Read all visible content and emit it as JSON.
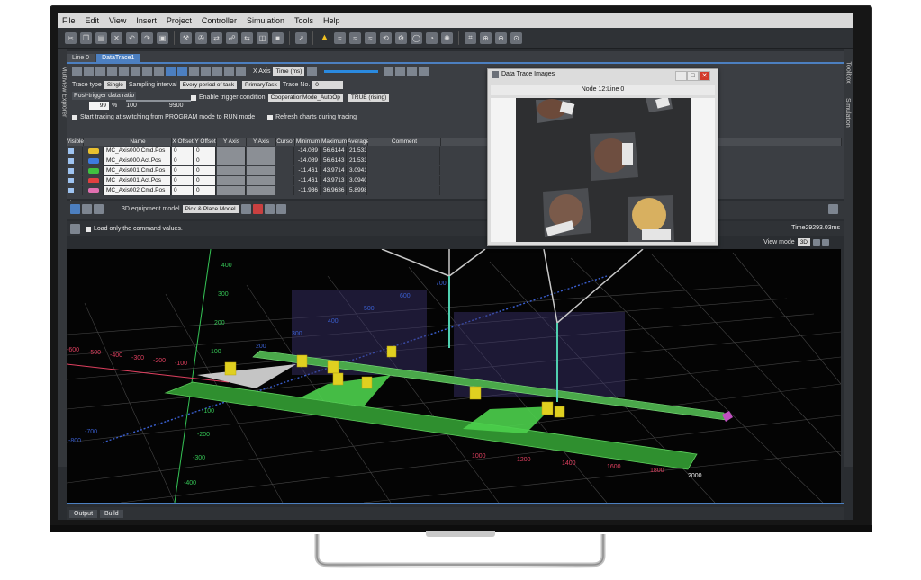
{
  "menu": [
    "File",
    "Edit",
    "View",
    "Insert",
    "Project",
    "Controller",
    "Simulation",
    "Tools",
    "Help"
  ],
  "side_labels": {
    "left": "Multiview Explorer",
    "right_top": "Toolbox",
    "right_bottom": "Simulation"
  },
  "tabs": [
    {
      "label": "Line 0",
      "active": false
    },
    {
      "label": "DataTrace1",
      "active": true
    }
  ],
  "trace": {
    "x_axis_label": "X Axis",
    "x_axis_value": "Time (ms)",
    "trace_type_label": "Trace type",
    "trace_type_value": "Single",
    "sampling_label": "Sampling interval",
    "sampling_value": "Every period of task",
    "task_value": "PrimaryTask",
    "trace_no_label": "Trace No.",
    "trace_no_value": "0",
    "post_trigger_label": "Post-trigger data ratio",
    "post_trigger_value": "99",
    "post_trigger_unit": "%",
    "slider_left": "100",
    "slider_right": "9900",
    "enable_trigger_label": "Enable trigger condition",
    "trigger_var": "CooperationMode_AutoOp",
    "trigger_cond": "TRUE (rising)",
    "start_tracing_label": "Start tracing at switching from PROGRAM mode to RUN mode",
    "refresh_label": "Refresh charts during tracing"
  },
  "grid": {
    "headers": [
      "Visible",
      "",
      "Name",
      "X Offset",
      "Y Offset",
      "Y Axis Min.",
      "Y Axis Max.",
      "Cursor",
      "Minimum",
      "Maximum",
      "Average",
      "Comment"
    ],
    "rows": [
      {
        "color": "#e8c030",
        "name": "MC_Axis000.Cmd.Pos",
        "x_offset": "0",
        "y_offset": "0",
        "min": "-14.089",
        "max": "56.6144",
        "avg": "21.533"
      },
      {
        "color": "#3d7be0",
        "name": "MC_Axis000.Act.Pos",
        "x_offset": "0",
        "y_offset": "0",
        "min": "-14.089",
        "max": "56.6143",
        "avg": "21.533"
      },
      {
        "color": "#40c040",
        "name": "MC_Axis001.Cmd.Pos",
        "x_offset": "0",
        "y_offset": "0",
        "min": "-11.461",
        "max": "43.9714",
        "avg": "3.0941"
      },
      {
        "color": "#e04040",
        "name": "MC_Axis001.Act.Pos",
        "x_offset": "0",
        "y_offset": "0",
        "min": "-11.461",
        "max": "43.9713",
        "avg": "3.0940"
      },
      {
        "color": "#e070b0",
        "name": "MC_Axis002.Cmd.Pos",
        "x_offset": "0",
        "y_offset": "0",
        "min": "-11.936",
        "max": "36.9636",
        "avg": "5.8998"
      }
    ]
  },
  "sim": {
    "equipment_label": "3D equipment model",
    "equipment_value": "Pick & Place Model",
    "load_label": "Load only the command values.",
    "time_readout": "Time29293.03ms",
    "view_mode_label": "View mode",
    "view_mode_value": "3D"
  },
  "axis_labels": {
    "y_ticks": [
      "400",
      "300",
      "200",
      "100",
      "-100",
      "-200",
      "-300",
      "-400"
    ],
    "x_ticks": [
      "-600",
      "-500",
      "-400",
      "-300",
      "-200",
      "-100",
      "-700",
      "-800"
    ],
    "z_ticks": [
      "200",
      "300",
      "400",
      "500",
      "600",
      "700"
    ],
    "bottom_ticks": [
      "1000",
      "1200",
      "1400",
      "1600",
      "1800",
      "2000"
    ]
  },
  "dti": {
    "title": "Data Trace Images",
    "node": "Node 12:Line 0"
  },
  "status_tabs": [
    "Output",
    "Build"
  ],
  "colors": {
    "accent": "#4c7fc0",
    "conveyor": "#3aa63a",
    "rail": "#5cb85c"
  }
}
